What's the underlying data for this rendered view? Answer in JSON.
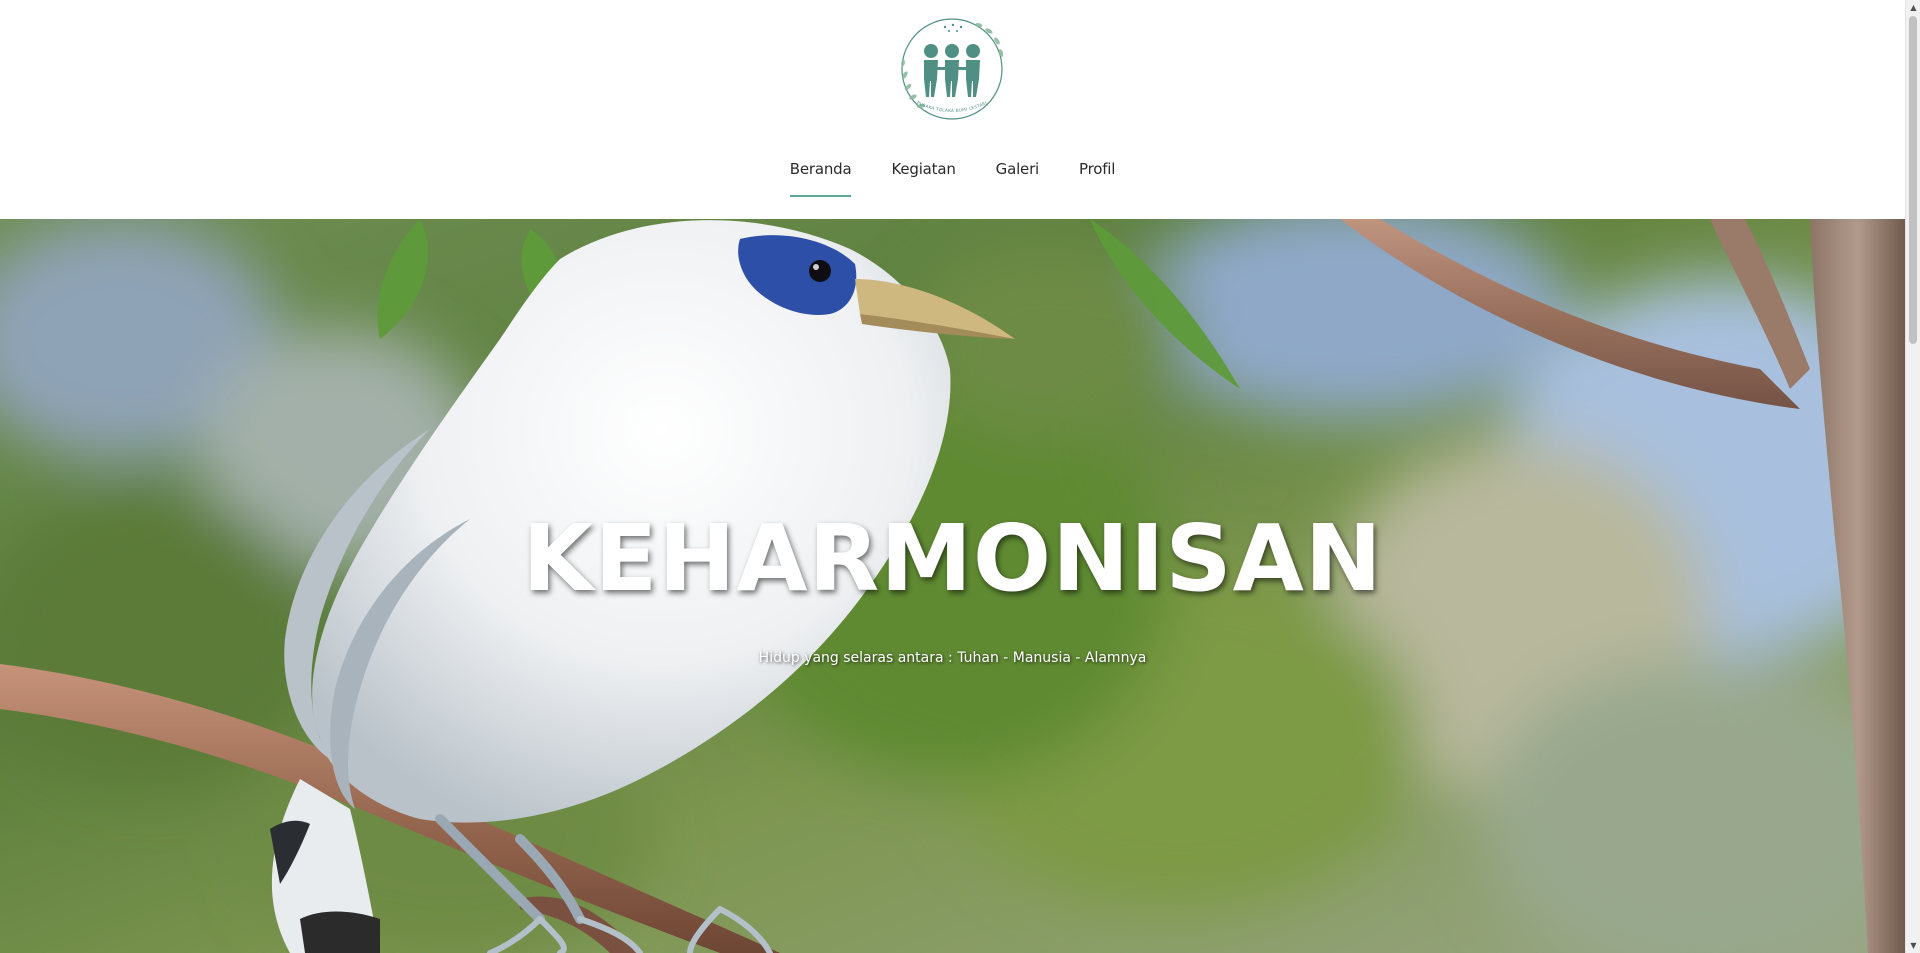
{
  "brand": {
    "logo_icon": "three-people-holding-hands-wreath-logo",
    "logo_text": "PUSAKA TOLAKA BUMI LESTARI",
    "accent_color": "#5ba89a",
    "logo_color": "#4f8f84"
  },
  "nav": {
    "items": [
      {
        "label": "Beranda",
        "active": true
      },
      {
        "label": "Kegiatan",
        "active": false
      },
      {
        "label": "Galeri",
        "active": false
      },
      {
        "label": "Profil",
        "active": false
      }
    ]
  },
  "hero": {
    "title": "KEHARMONISAN",
    "subtitle": "Hidup yang selaras antara : Tuhan - Manusia - Alamnya",
    "image_subject": "white-bird-on-branch"
  },
  "scrollbar": {
    "up_icon": "triangle-up-icon",
    "down_icon": "triangle-down-icon"
  }
}
